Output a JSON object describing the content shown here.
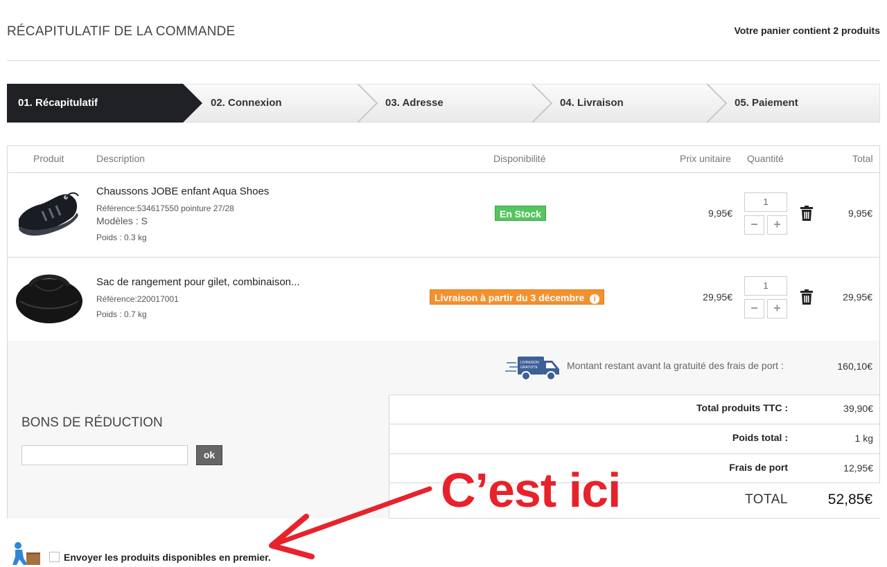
{
  "header": {
    "title": "RÉCAPITULATIF DE LA COMMANDE",
    "cart_count": "Votre panier contient 2 produits"
  },
  "steps": [
    "01. Récapitulatif",
    "02. Connexion",
    "03. Adresse",
    "04. Livraison",
    "05. Paiement"
  ],
  "table": {
    "headers": {
      "product": "Produit",
      "description": "Description",
      "availability": "Disponibilité",
      "unit_price": "Prix unitaire",
      "quantity": "Quantité",
      "total": "Total"
    },
    "items": [
      {
        "name": "Chaussons JOBE enfant Aqua Shoes",
        "reference": "Référence:534617550 pointure 27/28",
        "model": "Modèles : S",
        "weight": "Poids : 0.3 kg",
        "availability": "En Stock",
        "unit_price": "9,95€",
        "quantity": "1",
        "total": "9,95€"
      },
      {
        "name": "Sac de rangement pour gilet, combinaison...",
        "reference": "Référence:220017001",
        "weight": "Poids : 0.7 kg",
        "availability": "Livraison à partir du 3 décembre",
        "unit_price": "29,95€",
        "quantity": "1",
        "total": "29,95€"
      }
    ],
    "qty_minus": "−",
    "qty_plus": "+",
    "info_glyph": "i"
  },
  "shipping": {
    "remaining_label": "Montant restant avant la gratuité des frais de port :",
    "remaining_value": "160,10€",
    "truck_text_1": "LIVRAISON",
    "truck_text_2": "GRATUITE"
  },
  "coupon": {
    "title": "BONS DE RÉDUCTION",
    "input_value": "",
    "button": "ok"
  },
  "summary": {
    "products_label": "Total produits TTC :",
    "products_value": "39,90€",
    "weight_label": "Poids total :",
    "weight_value": "1 kg",
    "shipping_label": "Frais de port",
    "shipping_value": "12,95€",
    "total_label": "TOTAL",
    "total_value": "52,85€"
  },
  "annotation": {
    "text": "C’est ici"
  },
  "footer": {
    "checkbox_label": "Envoyer les produits disponibles en premier."
  },
  "colors": {
    "active_step": "#1f2125",
    "in_stock": "#55c65e",
    "delayed": "#f3912f",
    "annotation": "#e8222b"
  }
}
